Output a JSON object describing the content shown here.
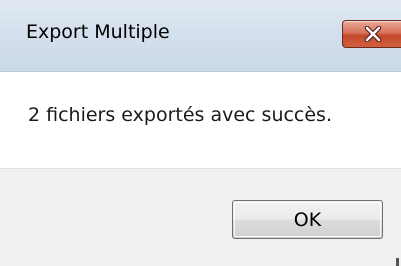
{
  "dialog": {
    "title": "Export Multiple",
    "message": "2 fichiers exportés avec succès.",
    "ok_label": "OK"
  },
  "colors": {
    "close_button": "#c24a2c",
    "titlebar": "#d3dfec",
    "footer": "#f0f0f0"
  },
  "icons": {
    "close": "close-icon"
  }
}
